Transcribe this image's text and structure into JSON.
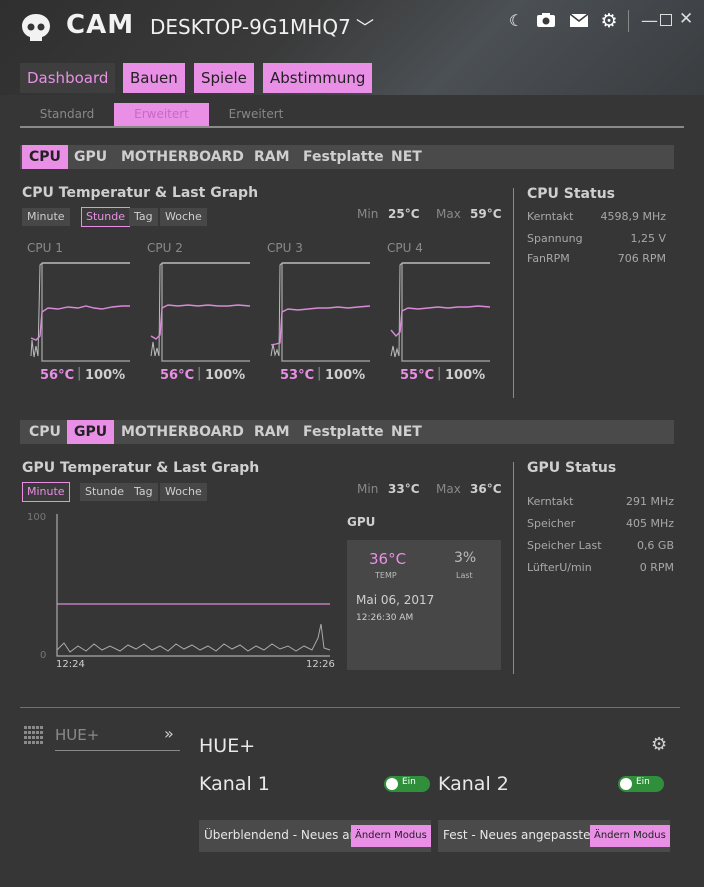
{
  "app": {
    "name": "CAM",
    "device": "DESKTOP-9G1MHQ7"
  },
  "main_tabs": [
    "Dashboard",
    "Bauen",
    "Spiele",
    "Abstimmung"
  ],
  "sub_tabs": [
    "Standard",
    "Erweitert",
    "Erweitert"
  ],
  "categories": [
    "CPU",
    "GPU",
    "MOTHERBOARD",
    "RAM",
    "Festplatte",
    "NET"
  ],
  "range_buttons": [
    "Minute",
    "Stunde",
    "Tag",
    "Woche"
  ],
  "cpu": {
    "title": "CPU Temperatur & Last Graph",
    "min_label": "Min",
    "min_value": "25°C",
    "max_label": "Max",
    "max_value": "59°C",
    "cores": [
      {
        "label": "CPU 1",
        "temp": "56°C",
        "load": "100%"
      },
      {
        "label": "CPU 2",
        "temp": "56°C",
        "load": "100%"
      },
      {
        "label": "CPU 3",
        "temp": "53°C",
        "load": "100%"
      },
      {
        "label": "CPU 4",
        "temp": "55°C",
        "load": "100%"
      }
    ],
    "separator": "|",
    "status": {
      "title": "CPU Status",
      "rows": [
        {
          "key": "Kerntakt",
          "value": "4598,9 MHz"
        },
        {
          "key": "Spannung",
          "value": "1,25 V"
        },
        {
          "key": "FanRPM",
          "value": "706 RPM"
        }
      ]
    }
  },
  "gpu": {
    "title": "GPU Temperatur & Last Graph",
    "min_label": "Min",
    "min_value": "33°C",
    "max_label": "Max",
    "max_value": "36°C",
    "graph": {
      "y_top": "100",
      "y_bottom": "0",
      "x_start": "12:24",
      "x_end": "12:26"
    },
    "card": {
      "heading": "GPU",
      "temp": "36°C",
      "temp_label": "TEMP",
      "last": "3%",
      "last_label": "Last",
      "date": "Mai 06, 2017",
      "time": "12:26:30 AM"
    },
    "status": {
      "title": "GPU Status",
      "rows": [
        {
          "key": "Kerntakt",
          "value": "291 MHz"
        },
        {
          "key": "Speicher",
          "value": "405 MHz"
        },
        {
          "key": "Speicher Last",
          "value": "0,6 GB"
        },
        {
          "key": "LüfterU/min",
          "value": "0 RPM"
        }
      ]
    }
  },
  "hue": {
    "selector": "HUE+",
    "chevrons": "»",
    "title": "HUE+",
    "channels": [
      {
        "name": "Kanal 1",
        "toggle": "Ein",
        "mode": "Überblendend - Neues an",
        "button": "Ändern Modus"
      },
      {
        "name": "Kanal 2",
        "toggle": "Ein",
        "mode": "Fest - Neues angepasstes",
        "button": "Ändern Modus"
      }
    ]
  },
  "colors": {
    "accent": "#e98fe6",
    "background": "#363636",
    "toggle_on": "#2f8f3b"
  }
}
